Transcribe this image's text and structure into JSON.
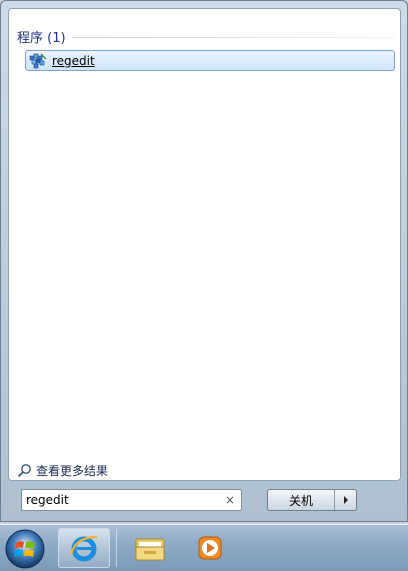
{
  "results": {
    "group_title": "程序 (1)",
    "items": [
      {
        "label": "regedit",
        "icon": "regedit-icon"
      }
    ]
  },
  "more_results": {
    "label": "查看更多结果",
    "icon": "magnifier-icon"
  },
  "search": {
    "value": "regedit",
    "clear_glyph": "×"
  },
  "shutdown": {
    "label": "关机",
    "arrow_icon": "right-arrow-icon"
  },
  "taskbar": {
    "items": [
      {
        "name": "start-orb",
        "icon": "windows-orb-icon"
      },
      {
        "name": "internet-explorer",
        "icon": "ie-icon",
        "active": true
      },
      {
        "name": "windows-explorer",
        "icon": "folder-icon"
      },
      {
        "name": "media-player",
        "icon": "media-player-icon"
      }
    ]
  },
  "colors": {
    "group_title": "#1e3287",
    "highlight_border": "#7da2ce",
    "highlight_fill": "#cfe4fa"
  }
}
